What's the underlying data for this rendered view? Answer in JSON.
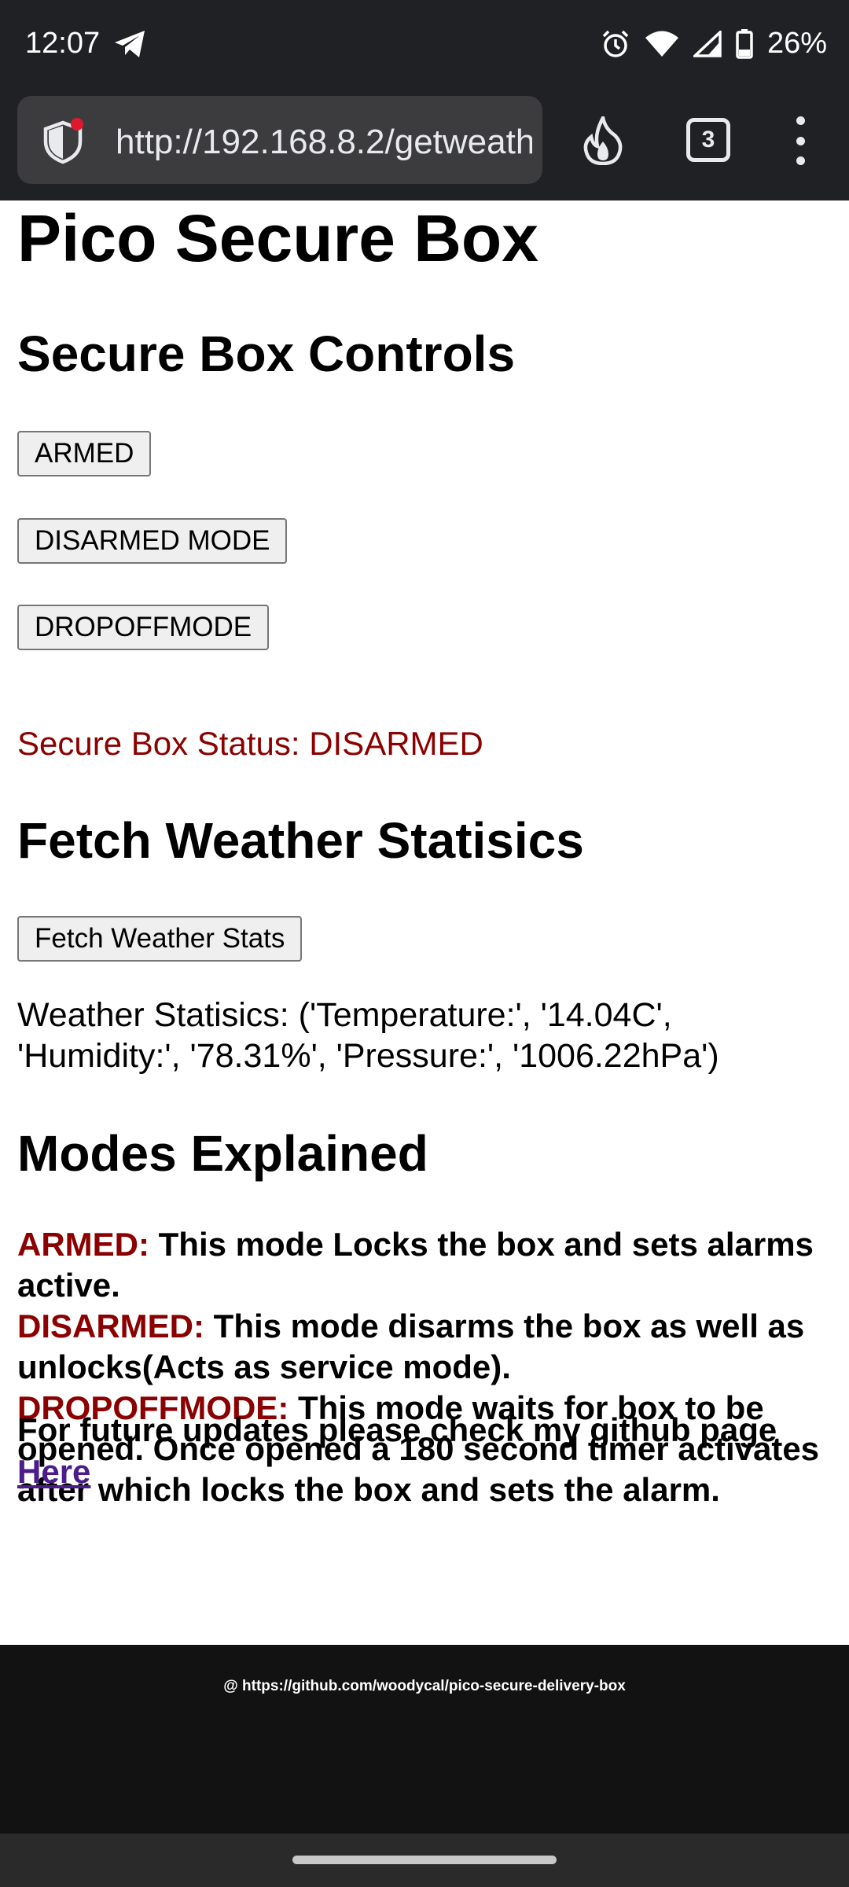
{
  "status_bar": {
    "time": "12:07",
    "battery": "26%",
    "icons": [
      "telegram-icon",
      "alarm-icon",
      "wifi-icon",
      "signal-icon",
      "battery-icon"
    ]
  },
  "browser": {
    "url": "http://192.168.8.2/getweather",
    "tab_count": "3",
    "icons": [
      "shield-icon",
      "flame-icon",
      "tabs-icon",
      "more-vert-icon"
    ]
  },
  "page": {
    "title": "Pico Secure Box",
    "controls_heading": "Secure Box Controls",
    "buttons": {
      "armed": "ARMED",
      "disarmed": "DISARMED MODE",
      "dropoff": "DROPOFFMODE"
    },
    "status_text": "Secure Box Status: DISARMED",
    "weather_heading": "Fetch Weather Statisics",
    "weather_button": "Fetch Weather Stats",
    "weather_stats": "Weather Statisics: ('Temperature:', '14.04C', 'Humidity:', '78.31%', 'Pressure:', '1006.22hPa')",
    "modes_heading": "Modes Explained",
    "modes": [
      {
        "name": "ARMED:",
        "desc": " This mode Locks the box and sets alarms active."
      },
      {
        "name": "DISARMED:",
        "desc": " This mode disarms the box as well as unlocks(Acts as service mode)."
      },
      {
        "name": "DROPOFFMODE:",
        "desc": " This mode waits for box to be opened. Once opened a 180 second timer activates after which locks the box and sets the alarm."
      }
    ],
    "future_text": "For future updates please check my github page",
    "link_text": "Here"
  },
  "footer": {
    "text": "@ https://github.com/woodycal/pico-secure-delivery-box"
  },
  "colors": {
    "status_red": "#8b0000",
    "link_purple": "#4b1c8a",
    "chrome_dark": "#202124"
  }
}
